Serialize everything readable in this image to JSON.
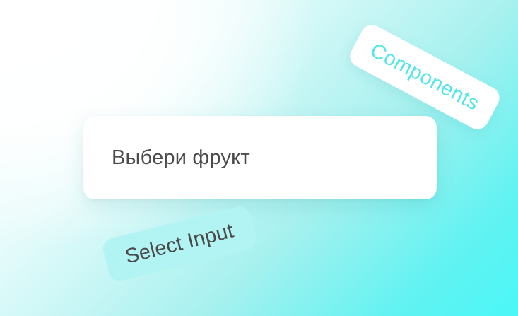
{
  "select_input": {
    "placeholder": "Выбери фрукт"
  },
  "tags": {
    "components": "Components",
    "select_input": "Select Input"
  },
  "colors": {
    "components_tag_text": "#53e6e8",
    "select_tag_background": "#b2f4f4",
    "background_accent": "#4bf7f7"
  }
}
